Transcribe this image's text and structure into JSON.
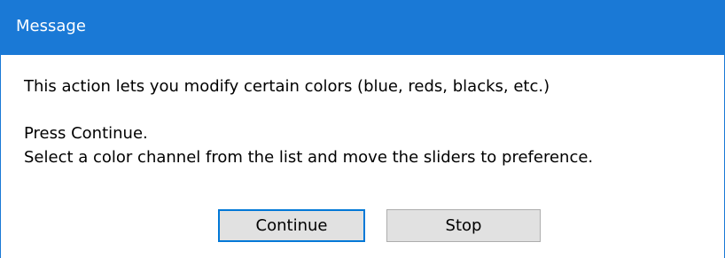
{
  "window": {
    "title": "Message"
  },
  "message": {
    "line1": "This action lets you modify certain colors (blue, reds, blacks, etc.)",
    "line2": "Press Continue.",
    "line3": "Select a color channel from the list and move the sliders to preference."
  },
  "buttons": {
    "continue_label": "Continue",
    "stop_label": "Stop"
  },
  "colors": {
    "title_bar": "#1a79d6",
    "button_face": "#e1e1e1",
    "default_button_border": "#0078d7"
  }
}
